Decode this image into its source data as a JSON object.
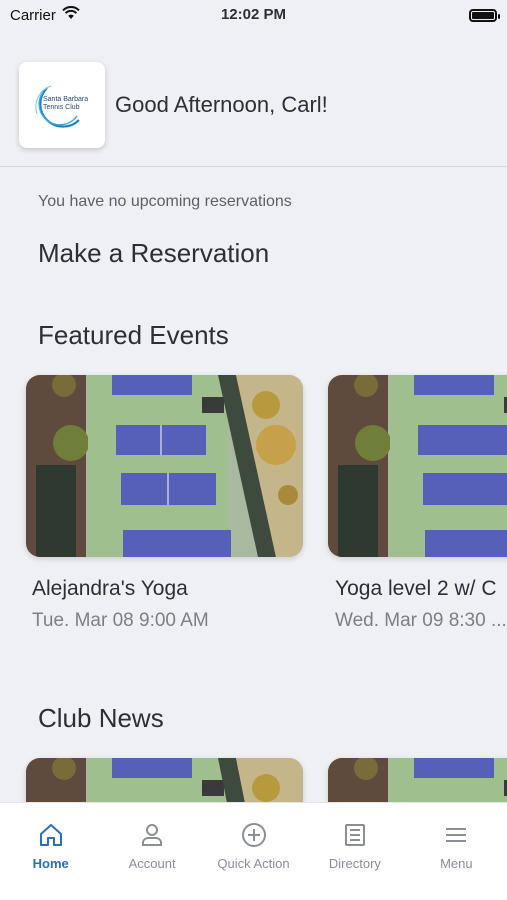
{
  "status_bar": {
    "carrier": "Carrier",
    "time": "12:02 PM",
    "icons": [
      "wifi-icon",
      "battery-icon"
    ]
  },
  "header": {
    "logo_text": [
      "Santa Barbara",
      "Tennis Club"
    ],
    "greeting": "Good Afternoon, Carl!"
  },
  "reservations": {
    "empty_message": "You have no upcoming reservations",
    "make_reservation_label": "Make a Reservation"
  },
  "featured_events": {
    "title": "Featured Events",
    "items": [
      {
        "title": "Alejandra's Yoga",
        "date": "Tue. Mar 08 9:00 AM"
      },
      {
        "title": "Yoga level 2 w/ C",
        "date": "Wed. Mar 09 8:30 ..."
      }
    ]
  },
  "club_news": {
    "title": "Club News"
  },
  "tabbar": {
    "items": [
      {
        "label": "Home",
        "icon": "home-icon",
        "active": true
      },
      {
        "label": "Account",
        "icon": "account-icon",
        "active": false
      },
      {
        "label": "Quick Action",
        "icon": "plus-circle-icon",
        "active": false
      },
      {
        "label": "Directory",
        "icon": "directory-icon",
        "active": false
      },
      {
        "label": "Menu",
        "icon": "menu-icon",
        "active": false
      }
    ]
  },
  "colors": {
    "accent": "#2a6fb7",
    "background": "#eef0f4",
    "inactive": "#8a8e95"
  }
}
